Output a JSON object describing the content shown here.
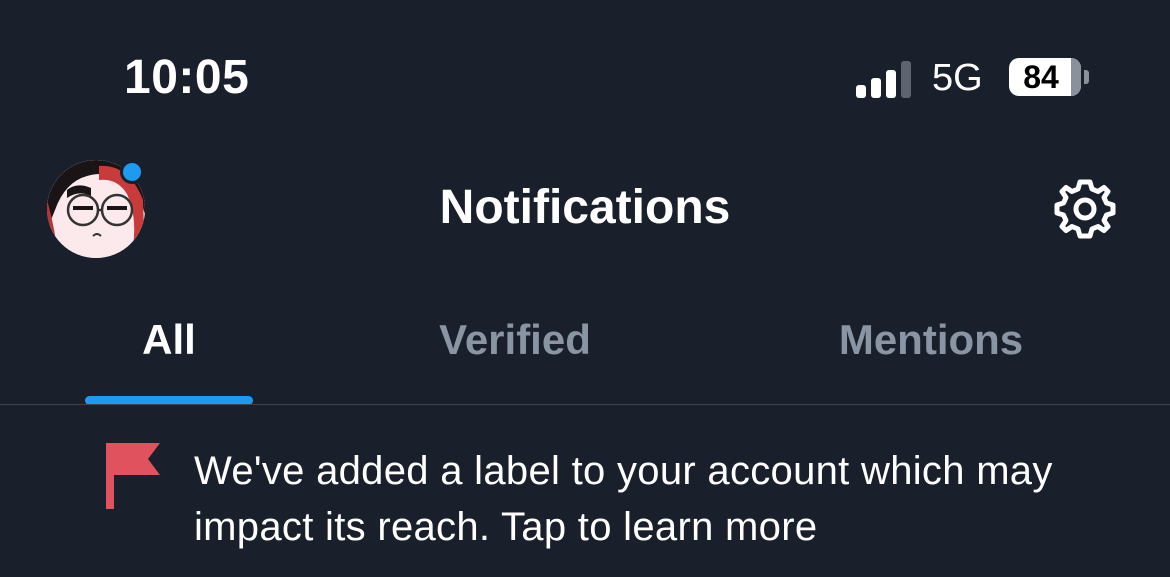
{
  "status_bar": {
    "time": "10:05",
    "network": "5G",
    "battery_level": "84"
  },
  "header": {
    "title": "Notifications",
    "avatar_icon": "avatar",
    "settings_icon": "gear-icon",
    "unread_dot_color": "#1d9bf0"
  },
  "tabs": [
    {
      "label": "All",
      "selected": true
    },
    {
      "label": "Verified",
      "selected": false
    },
    {
      "label": "Mentions",
      "selected": false
    }
  ],
  "notification": {
    "icon": "flag-icon",
    "icon_color": "#e0525d",
    "text": "We've added a label to your account which may impact its reach. Tap to learn more"
  },
  "colors": {
    "background": "#19202b",
    "accent": "#1d9bf0",
    "inactive_tab": "#8a95a3"
  }
}
